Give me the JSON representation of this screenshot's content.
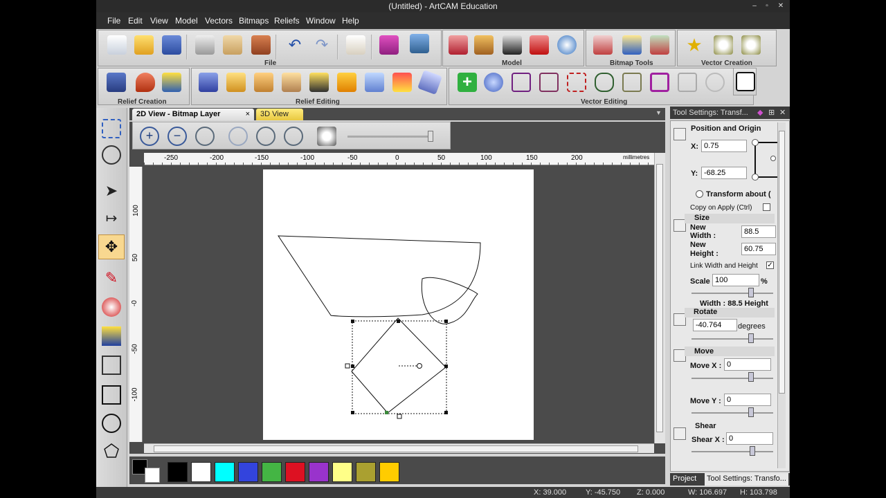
{
  "window": {
    "title": "(Untitled) - ArtCAM Education",
    "min": "–",
    "max": "▫",
    "close": "✕"
  },
  "menu": [
    "File",
    "Edit",
    "View",
    "Model",
    "Vectors",
    "Bitmaps",
    "Reliefs",
    "Window",
    "Help"
  ],
  "toolbars": {
    "file": "File",
    "model": "Model",
    "bitmap_tools": "Bitmap Tools",
    "vector_creation": "Vector Creation",
    "relief_creation": "Relief Creation",
    "relief_editing": "Relief Editing",
    "vector_editing": "Vector Editing"
  },
  "tabs": {
    "active": "2D View - Bitmap Layer",
    "close": "×",
    "other": "3D View",
    "dropdown": "▼"
  },
  "ruler": {
    "h_ticks": [
      "-250",
      "-200",
      "-150",
      "-100",
      "-50",
      "0",
      "50",
      "100",
      "150",
      "200"
    ],
    "unit": "millimetres",
    "v_ticks": [
      "100",
      "50",
      "-0",
      "-50",
      "-100"
    ]
  },
  "palette": {
    "colors": [
      "#000000",
      "#ffffff",
      "#00ffff",
      "#3344dd",
      "#44b544",
      "#dd1122",
      "#9933cc",
      "#ffff88",
      "#aaa030",
      "#ffcc00"
    ]
  },
  "panel": {
    "title": "Tool Settings: Transf...",
    "position_origin": "Position and Origin",
    "x_label": "X:",
    "x_value": "0.75",
    "y_label": "Y:",
    "y_value": "-68.25",
    "transform_about": "Transform about (",
    "copy_on_apply": "Copy on Apply (Ctrl)",
    "size": "Size",
    "new_width_label": "New\nWidth :",
    "new_width": "88.5",
    "new_height_label": "New\nHeight :",
    "new_height": "60.75",
    "link_wh": "Link Width and Height",
    "scale_label": "Scale",
    "scale_value": "100",
    "scale_unit": "%",
    "width_height_readout": "Width : 88.5  Height",
    "rotate": "Rotate",
    "rotate_value": "-40.764",
    "degrees": "degrees",
    "move": "Move",
    "move_x_label": "Move X :",
    "move_x": "0",
    "move_y_label": "Move Y :",
    "move_y": "0",
    "shear": "Shear",
    "shear_x_label": "Shear X :",
    "shear_x": "0"
  },
  "bottom_tabs": {
    "project": "Project",
    "tool_settings": "Tool Settings: Transfo..."
  },
  "status": {
    "x": "X: 39.000",
    "y": "Y: -45.750",
    "z": "Z: 0.000",
    "w": "W: 106.697",
    "h": "H: 103.798"
  }
}
